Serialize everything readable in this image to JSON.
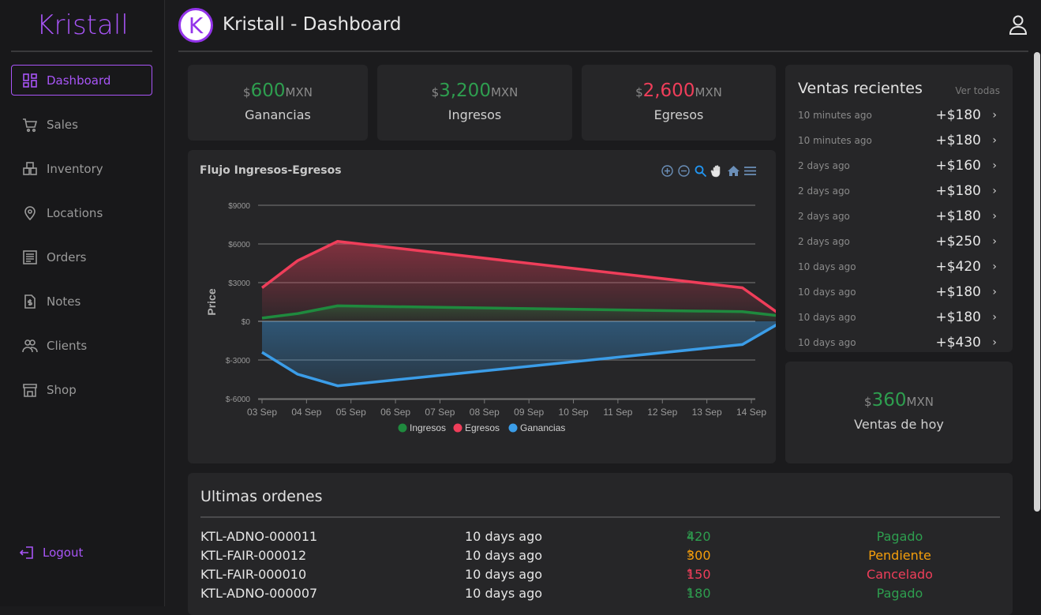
{
  "app": {
    "brand": "Kristall",
    "avatar_letter": "K",
    "page_title": "Kristall - Dashboard"
  },
  "sidebar": {
    "items": [
      {
        "label": "Dashboard",
        "icon": "dashboard-icon",
        "active": true
      },
      {
        "label": "Sales",
        "icon": "cart-icon"
      },
      {
        "label": "Inventory",
        "icon": "boxes-icon"
      },
      {
        "label": "Locations",
        "icon": "map-pin-icon"
      },
      {
        "label": "Orders",
        "icon": "receipt-icon"
      },
      {
        "label": "Notes",
        "icon": "invoice-icon"
      },
      {
        "label": "Clients",
        "icon": "users-icon"
      },
      {
        "label": "Shop",
        "icon": "store-icon"
      }
    ],
    "logout_label": "Logout"
  },
  "stats": [
    {
      "currency": "$",
      "value": "600",
      "unit": "MXN",
      "label": "Ganancias",
      "color": "#2e9e4f"
    },
    {
      "currency": "$",
      "value": "3,200",
      "unit": "MXN",
      "label": "Ingresos",
      "color": "#2e9e4f"
    },
    {
      "currency": "$",
      "value": "2,600",
      "unit": "MXN",
      "label": "Egresos",
      "color": "#ef3e5a"
    }
  ],
  "today": {
    "currency": "$",
    "value": "360",
    "unit": "MXN",
    "label": "Ventas de hoy"
  },
  "recent": {
    "title": "Ventas recientes",
    "view_all": "Ver todas",
    "items": [
      {
        "time": "10 minutes ago",
        "amount": "+$180"
      },
      {
        "time": "10 minutes ago",
        "amount": "+$180"
      },
      {
        "time": "2 days ago",
        "amount": "+$160"
      },
      {
        "time": "2 days ago",
        "amount": "+$180"
      },
      {
        "time": "2 days ago",
        "amount": "+$180"
      },
      {
        "time": "2 days ago",
        "amount": "+$250"
      },
      {
        "time": "10 days ago",
        "amount": "+$420"
      },
      {
        "time": "10 days ago",
        "amount": "+$180"
      },
      {
        "time": "10 days ago",
        "amount": "+$180"
      },
      {
        "time": "10 days ago",
        "amount": "+$430"
      }
    ]
  },
  "orders": {
    "title": "Ultimas ordenes",
    "rows": [
      {
        "id": "KTL-ADNO-000011",
        "time": "10 days ago",
        "currency": "$",
        "amount": "420",
        "status": "Pagado",
        "color": "#2e9e4f"
      },
      {
        "id": "KTL-FAIR-000012",
        "time": "10 days ago",
        "currency": "$",
        "amount": "300",
        "status": "Pendiente",
        "color": "#f59e0b"
      },
      {
        "id": "KTL-FAIR-000010",
        "time": "10 days ago",
        "currency": "$",
        "amount": "150",
        "status": "Cancelado",
        "color": "#ef3e5a"
      },
      {
        "id": "KTL-ADNO-000007",
        "time": "10 days ago",
        "currency": "$",
        "amount": "180",
        "status": "Pagado",
        "color": "#2e9e4f"
      }
    ]
  },
  "chart_data": {
    "type": "area",
    "title": "Flujo Ingresos-Egresos",
    "ylabel": "Price",
    "xlabel": "",
    "categories": [
      "03 Sep",
      "04 Sep",
      "05 Sep",
      "06 Sep",
      "07 Sep",
      "08 Sep",
      "09 Sep",
      "10 Sep",
      "11 Sep",
      "12 Sep",
      "13 Sep",
      "14 Sep"
    ],
    "yticks": [
      "$9000",
      "$6000",
      "$3000",
      "$0",
      "$-3000",
      "$-6000"
    ],
    "ylim": [
      -6000,
      9000
    ],
    "series": [
      {
        "name": "Ingresos",
        "color": "#1f8a3e",
        "points": [
          [
            0,
            250
          ],
          [
            0.8,
            600
          ],
          [
            1.7,
            1200
          ],
          [
            10.8,
            750
          ],
          [
            11.7,
            400
          ]
        ]
      },
      {
        "name": "Egresos",
        "color": "#ef3e5a",
        "points": [
          [
            0,
            2600
          ],
          [
            0.8,
            4700
          ],
          [
            1.7,
            6200
          ],
          [
            10.8,
            2600
          ],
          [
            11.7,
            400
          ]
        ]
      },
      {
        "name": "Ganancias",
        "color": "#3b9de8",
        "points": [
          [
            0,
            -2400
          ],
          [
            0.8,
            -4100
          ],
          [
            1.7,
            -5000
          ],
          [
            10.8,
            -1800
          ],
          [
            11.7,
            0
          ]
        ]
      }
    ],
    "legend": "bottom",
    "grid": true,
    "toolbar_icons": [
      "zoom-in-icon",
      "zoom-out-icon",
      "magnifier-icon",
      "pan-hand-icon",
      "home-icon",
      "menu-icon"
    ]
  }
}
